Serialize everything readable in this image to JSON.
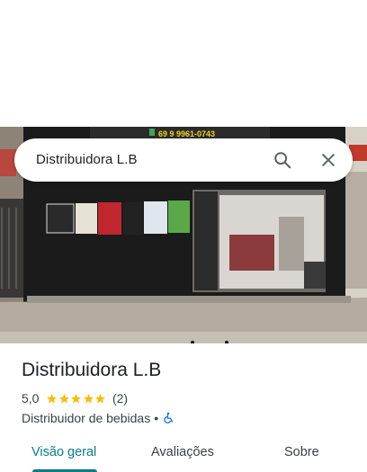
{
  "search": {
    "query": "Distribuidora L.B"
  },
  "photo": {
    "sign_text": "69 9 9961-0743"
  },
  "place": {
    "name": "Distribuidora L.B",
    "rating": "5,0",
    "stars": 5,
    "review_count": "(2)",
    "category": "Distribuidor de bebidas",
    "separator": "•"
  },
  "tabs": [
    {
      "label": "Visão geral",
      "active": true
    },
    {
      "label": "Avaliações",
      "active": false
    },
    {
      "label": "Sobre",
      "active": false
    }
  ],
  "colors": {
    "accent": "#0b7a8c",
    "star": "#fbbc04",
    "accessibility": "#1a73e8"
  }
}
